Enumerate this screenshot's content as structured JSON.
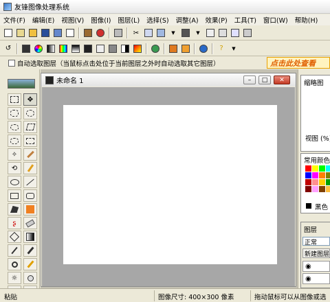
{
  "window": {
    "title": "友锋图像处理系统"
  },
  "menu": [
    "文件(F)",
    "编辑(E)",
    "视图(V)",
    "图像(I)",
    "图层(L)",
    "选择(S)",
    "调整(A)",
    "效果(P)",
    "工具(T)",
    "窗口(W)",
    "帮助(H)"
  ],
  "options": {
    "auto_select_label": "自动选取图层（当鼠标点击处位于当前图层之外时自动选取其它图层）"
  },
  "banner": {
    "text": "点击此处查看"
  },
  "document": {
    "title": "未命名 1"
  },
  "right_panel": {
    "thumbnail_tab": "缩略图",
    "view_label": "视图 (%)",
    "colors_title": "常用颜色",
    "black_label": "黑色",
    "layers_tab": "图层",
    "blend_mode": "正常",
    "new_layer": "新建图层"
  },
  "status": {
    "left": "粘贴",
    "center": "图像尺寸: 400×300 像素",
    "right": "拖动鼠标可以从图像或选"
  },
  "swatch_colors": [
    "#ff0000",
    "#ffff00",
    "#00ff00",
    "#00ffff",
    "#0000ff",
    "#ff00ff",
    "#ff8000",
    "#808000",
    "#c00000",
    "#ff9090",
    "#ffd000",
    "#00a000",
    "#800000",
    "#ffa0ff",
    "#804000",
    "#ffc040"
  ]
}
